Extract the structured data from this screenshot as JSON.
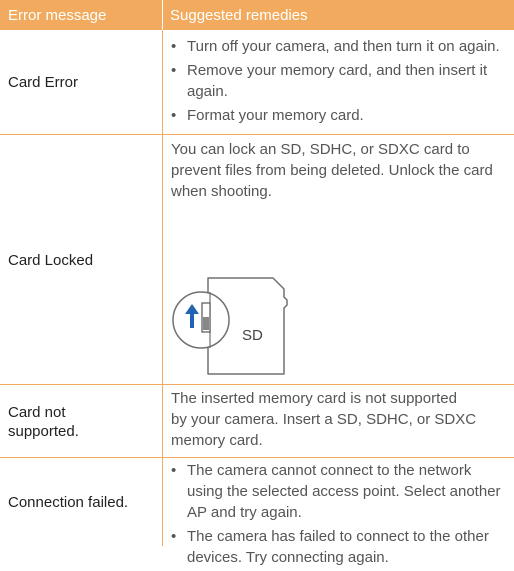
{
  "header": {
    "col_error": "Error message",
    "col_remedies": "Suggested remedies"
  },
  "rows": [
    {
      "error": "Card Error",
      "remedies": [
        "Turn off your camera, and then turn it on again.",
        "Remove your memory card, and then insert it again.",
        "Format your memory card."
      ]
    },
    {
      "error": "Card Locked",
      "remedy_lines": [
        "You can lock an SD, SDHC, or SDXC card to",
        "prevent files from being deleted. Unlock the card",
        "when shooting."
      ],
      "illustration_label": "SD"
    },
    {
      "error": "Card not supported.",
      "remedy_lines": [
        "The inserted memory card is not supported",
        "by your camera. Insert a SD, SDHC, or SDXC",
        "memory card."
      ]
    },
    {
      "error": "Connection failed.",
      "remedies": [
        "The camera cannot connect to the network using the selected access point. Select another AP and try again.",
        "The camera has failed to connect to the other devices. Try connecting again."
      ]
    }
  ],
  "colors": {
    "accent": "#f2ab5e",
    "header_text": "#ffffff",
    "body_text": "#555555"
  }
}
